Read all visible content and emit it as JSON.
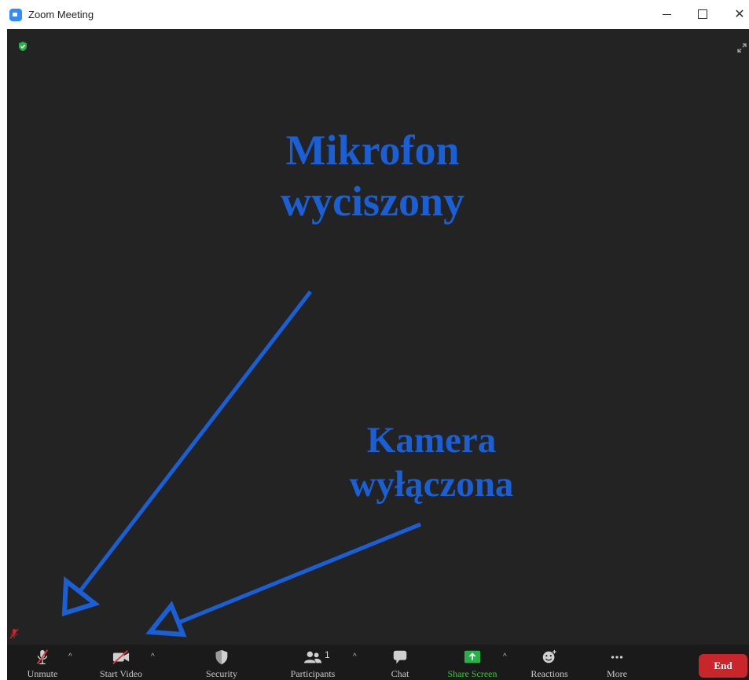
{
  "window": {
    "title": "Zoom Meeting",
    "controls": [
      "minimize-icon",
      "maximize-icon",
      "close-icon"
    ],
    "close_glyph": "✕"
  },
  "meeting": {
    "background": "#232323",
    "annotation_color": "#1a5fd6",
    "caption_mic": "Mikrofon wyciszony",
    "caption_camera": "Kamera wyłączona"
  },
  "toolbar": {
    "unmute_label": "Unmute",
    "start_video_label": "Start Video",
    "security_label": "Security",
    "participants_label": "Participants",
    "participants_count": "1",
    "chat_label": "Chat",
    "share_screen_label": "Share Screen",
    "reactions_label": "Reactions",
    "more_label": "More",
    "end_label": "End",
    "caret": "^",
    "share_color": "#33cc33",
    "end_color": "#c9262c"
  }
}
